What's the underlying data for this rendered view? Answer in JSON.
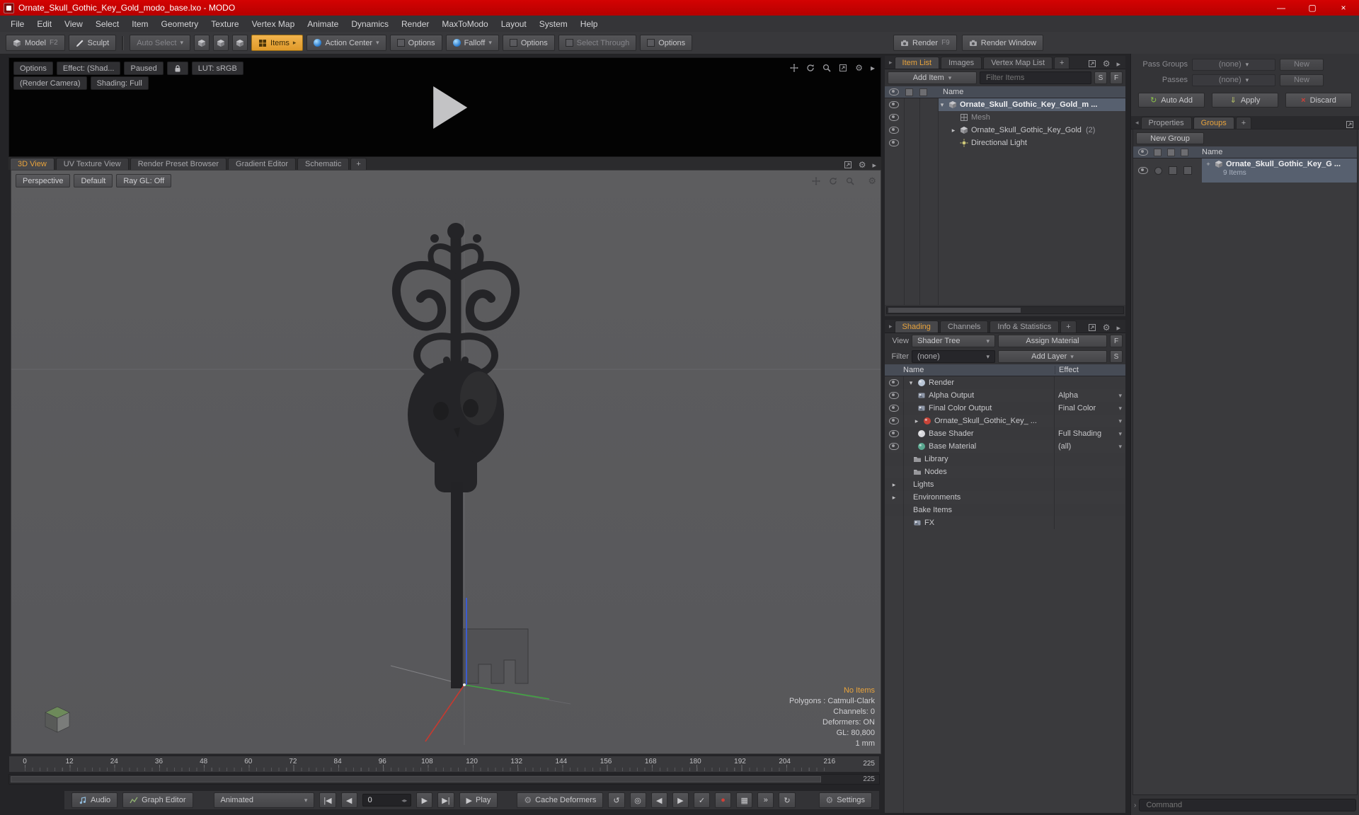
{
  "colors": {
    "accent_orange": "#e8a33c",
    "titlebar_red": "#c40000",
    "selection_blue": "#57606f",
    "viewport_gray": "#59595b"
  },
  "window": {
    "title": "Ornate_Skull_Gothic_Key_Gold_modo_base.lxo - MODO"
  },
  "menu": {
    "items": [
      "File",
      "Edit",
      "View",
      "Select",
      "Item",
      "Geometry",
      "Texture",
      "Vertex Map",
      "Animate",
      "Dynamics",
      "Render",
      "MaxToModo",
      "Layout",
      "System",
      "Help"
    ]
  },
  "toolbar": {
    "model": "Model",
    "model_key": "F2",
    "sculpt": "Sculpt",
    "auto_select": "Auto Select",
    "items": "Items",
    "action_center": "Action Center",
    "options_a": "Options",
    "falloff": "Falloff",
    "options_b": "Options",
    "select_through": "Select Through",
    "options_c": "Options",
    "render": "Render",
    "render_key": "F9",
    "render_window": "Render Window"
  },
  "preview": {
    "options": "Options",
    "effect": "Effect: (Shad...",
    "paused": "Paused",
    "lut": "LUT: sRGB",
    "render_camera": "(Render Camera)",
    "shading_mode": "Shading: Full"
  },
  "viewport": {
    "tabs": [
      "3D View",
      "UV Texture View",
      "Render Preset Browser",
      "Gradient Editor",
      "Schematic"
    ],
    "add_tab": "+",
    "perspective": "Perspective",
    "default_btn": "Default",
    "ray_gl": "Ray GL: Off",
    "info": {
      "no_items": "No Items",
      "polygons": "Polygons : Catmull-Clark",
      "channels": "Channels: 0",
      "deformers": "Deformers: ON",
      "gl": "GL: 80,800",
      "scale": "1 mm"
    }
  },
  "timeline": {
    "ticks": [
      "0",
      "12",
      "24",
      "36",
      "48",
      "60",
      "72",
      "84",
      "96",
      "108",
      "120",
      "132",
      "144",
      "156",
      "168",
      "180",
      "192",
      "204",
      "216"
    ],
    "end": "225",
    "range_end": "225"
  },
  "transport": {
    "audio": "Audio",
    "graph_editor": "Graph Editor",
    "animated": "Animated",
    "frame": "0",
    "play": "Play",
    "cache_deformers": "Cache Deformers",
    "settings": "Settings"
  },
  "item_list": {
    "tabs": [
      "Item List",
      "Images",
      "Vertex Map List"
    ],
    "add_tab": "+",
    "add_item": "Add Item",
    "filter_placeholder": "Filter Items",
    "s_button": "S",
    "f_button": "F",
    "name_header": "Name",
    "rows": [
      {
        "label": "Ornate_Skull_Gothic_Key_Gold_m ..."
      },
      {
        "label": "Mesh"
      },
      {
        "label": "Ornate_Skull_Gothic_Key_Gold",
        "count": "(2)"
      },
      {
        "label": "Directional Light"
      }
    ]
  },
  "shading": {
    "tabs": [
      "Shading",
      "Channels",
      "Info & Statistics"
    ],
    "add_tab": "+",
    "view_label": "View",
    "view_value": "Shader Tree",
    "assign_material": "Assign Material",
    "f_button": "F",
    "filter_label": "Filter",
    "filter_value": "(none)",
    "add_layer": "Add Layer",
    "s_button": "S",
    "name_header": "Name",
    "effect_header": "Effect",
    "rows": [
      {
        "label": "Render",
        "effect": ""
      },
      {
        "label": "Alpha Output",
        "effect": "Alpha"
      },
      {
        "label": "Final Color Output",
        "effect": "Final Color"
      },
      {
        "label": "Ornate_Skull_Gothic_Key_ ...",
        "effect": ""
      },
      {
        "label": "Base Shader",
        "effect": "Full Shading"
      },
      {
        "label": "Base Material",
        "effect": "(all)"
      },
      {
        "label": "Library",
        "effect": ""
      },
      {
        "label": "Nodes",
        "effect": ""
      },
      {
        "label": "Lights",
        "effect": ""
      },
      {
        "label": "Environments",
        "effect": ""
      },
      {
        "label": "Bake Items",
        "effect": ""
      },
      {
        "label": "FX",
        "effect": ""
      }
    ]
  },
  "groups_panel": {
    "pass_groups_label": "Pass Groups",
    "pass_groups_value": "(none)",
    "pass_groups_new": "New",
    "passes_label": "Passes",
    "passes_value": "(none)",
    "passes_new": "New",
    "auto_add": "Auto Add",
    "apply": "Apply",
    "discard": "Discard",
    "tabs": [
      "Properties",
      "Groups"
    ],
    "add_tab": "+",
    "new_group": "New Group",
    "name_header": "Name",
    "group_name": "Ornate_Skull_Gothic_Key_G ...",
    "group_count": "9 Items",
    "command_placeholder": "Command"
  }
}
